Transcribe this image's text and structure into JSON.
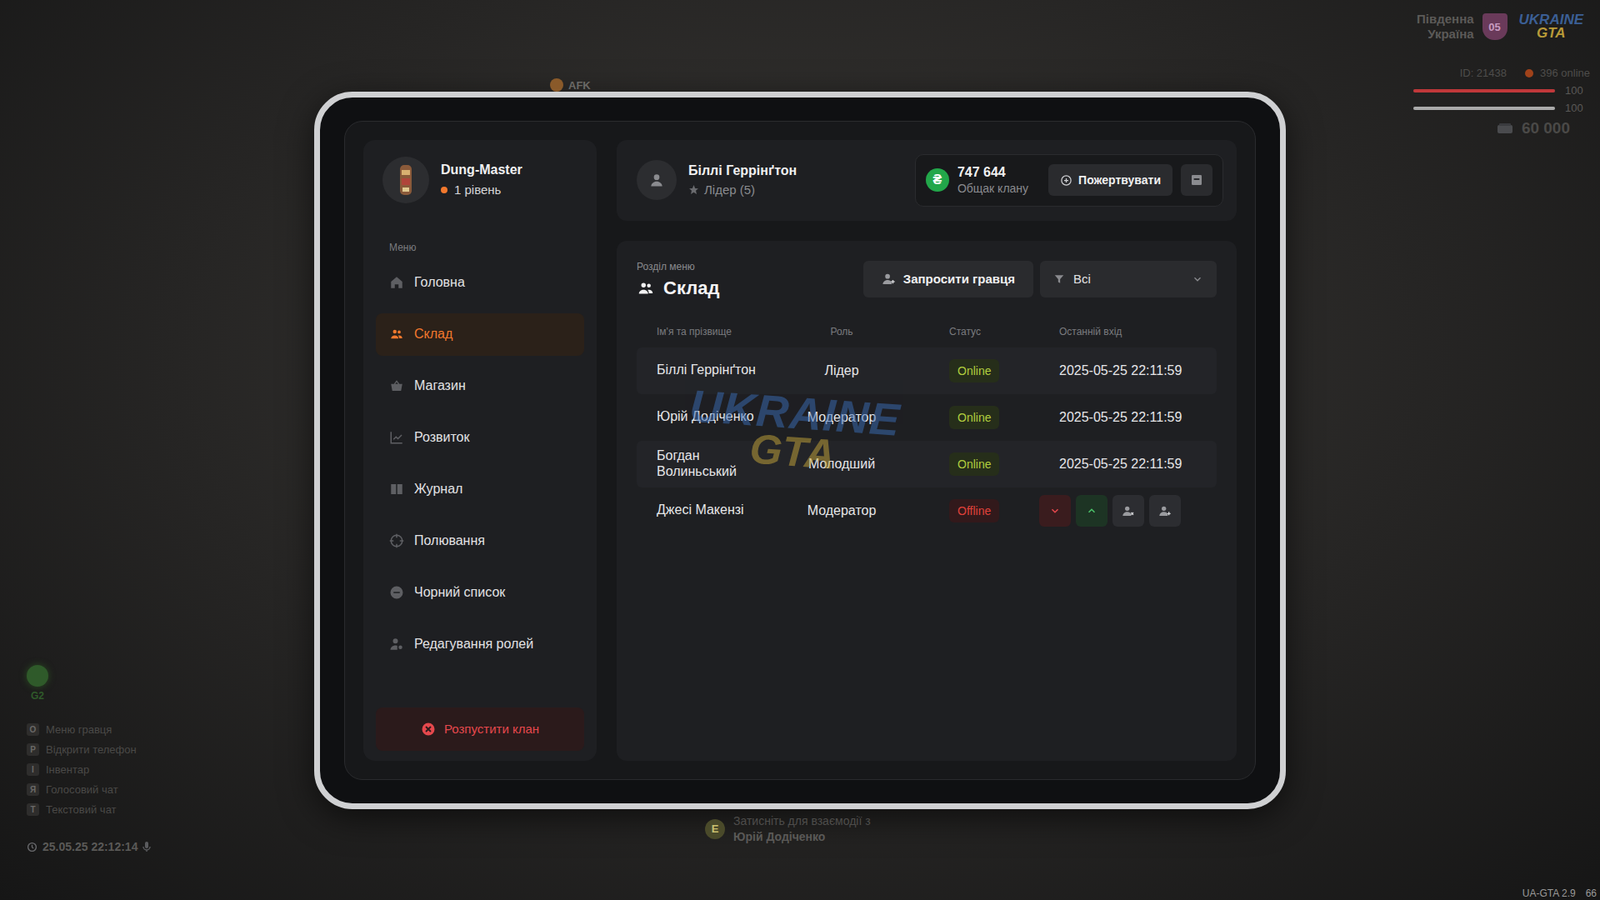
{
  "hud": {
    "afk": "AFK",
    "region": [
      "Південна",
      "Україна"
    ],
    "region_badge": "05",
    "logo": [
      "UKRAINE",
      "GTA"
    ],
    "player_id": "ID: 21438",
    "online": "396 online",
    "health": {
      "level": 1,
      "reading": "100"
    },
    "armor": {
      "level": 1,
      "reading": "100"
    },
    "money": "60 000",
    "voice": "G2",
    "hotkeys": [
      {
        "key": "O",
        "label": "Меню гравця"
      },
      {
        "key": "P",
        "label": "Відкрити телефон"
      },
      {
        "key": "I",
        "label": "Інвентар"
      },
      {
        "key": "Я",
        "label": "Голосовий чат"
      },
      {
        "key": "T",
        "label": "Текстовий чат"
      }
    ],
    "datetime": "25.05.25 22:12:14",
    "interact": {
      "key": "E",
      "text": "Затисніть для взаємодії з",
      "name": "Юрій Додіченко"
    },
    "version": "UA-GTA 2.9",
    "fps": "66"
  },
  "profile": {
    "name": "Dung-Master",
    "level": "1 рівень"
  },
  "sidebar": {
    "section": "Меню",
    "items": [
      {
        "label": "Головна",
        "selected": false
      },
      {
        "label": "Склад",
        "selected": true
      },
      {
        "label": "Магазин",
        "selected": false
      },
      {
        "label": "Розвиток",
        "selected": false
      },
      {
        "label": "Журнал",
        "selected": false
      },
      {
        "label": "Полювання",
        "selected": false
      },
      {
        "label": "Чорний список",
        "selected": false
      },
      {
        "label": "Редагування ролей",
        "selected": false
      }
    ],
    "disband": "Розпустити клан"
  },
  "leader": {
    "name": "Біллі Геррінґтон",
    "role": "Лідер (5)"
  },
  "treasury": {
    "currency": "₴",
    "amount": "747 644",
    "label": "Общак клану",
    "donate": "Пожертвувати"
  },
  "section": {
    "caption": "Розділ меню",
    "title": "Склад"
  },
  "invite": "Запросити гравця",
  "filter": {
    "value": "Всі"
  },
  "table": {
    "columns": [
      "Ім'я та прізвище",
      "Роль",
      "Статус",
      "Останній вхід"
    ],
    "rows": [
      {
        "name": "Біллі Геррінґтон",
        "role": "Лідер",
        "status": "Online",
        "online": true,
        "last_login": "2025-05-25 22:11:59",
        "hovered": false
      },
      {
        "name": "Юрій Додіченко",
        "role": "Модератор",
        "status": "Online",
        "online": true,
        "last_login": "2025-05-25 22:11:59",
        "hovered": false
      },
      {
        "name": "Богдан Волиньський",
        "role": "Молодший",
        "status": "Online",
        "online": true,
        "last_login": "2025-05-25 22:11:59",
        "hovered": false
      },
      {
        "name": "Джесі Макензі",
        "role": "Модератор",
        "status": "Offline",
        "online": false,
        "last_login": "",
        "hovered": true
      }
    ]
  },
  "watermark": [
    "UKRAINE",
    "GTA"
  ]
}
